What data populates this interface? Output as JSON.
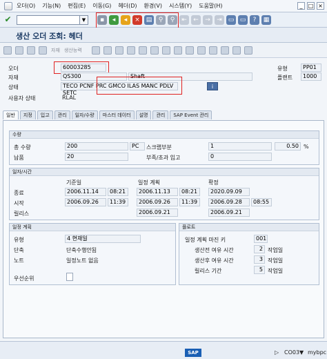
{
  "menu": {
    "items": [
      "오더(O)",
      "기능(N)",
      "편집(E)",
      "이동(G)",
      "헤더(D)",
      "환경(V)",
      "시스템(Y)",
      "도움말(H)"
    ]
  },
  "title": "생산 오더 조회: 헤더",
  "toolbar2": {
    "labels": [
      "자재",
      "생산능력"
    ]
  },
  "header": {
    "order_label": "오더",
    "order_value": "60003285",
    "type_label": "유형",
    "type_value": "PP01",
    "material_label": "자재",
    "material_value": "QS300",
    "material_desc": "Shaft",
    "plant_label": "플랜트",
    "plant_value": "1000",
    "status_label": "상태",
    "status_value": "TECO PCNF PRC  GMCO ILAS MANC PDLV SETC",
    "info_icon": "i",
    "user_status_label": "사용자 상태",
    "user_status_value": "RLAL"
  },
  "tabs": [
    "일반",
    "지정",
    "입고",
    "관리",
    "일자/수량",
    "마스터 데이터",
    "설명",
    "관리",
    "SAP Event 관리"
  ],
  "quantity": {
    "group_title": "수량",
    "total_label": "총 수량",
    "total_value": "200",
    "unit": "PC",
    "scrap_label": "스크랩부분",
    "scrap_value": "1",
    "scrap_pct": "0.50",
    "pct_sign": "%",
    "delivered_label": "납품",
    "delivered_value": "20",
    "short_label": "부족/초과 입고",
    "short_value": "0"
  },
  "dates": {
    "group_title": "일자/시간",
    "col_basic": "기준일",
    "col_sched": "일정 계획",
    "col_confirmed": "확정",
    "end_label": "종료",
    "end_basic": "2006.11.14",
    "end_basic_time": "08:21",
    "end_sched": "2006.11.13",
    "end_sched_time": "08:21",
    "end_confirmed": "2020.09.09",
    "start_label": "시작",
    "start_basic": "2006.09.26",
    "start_basic_time": "11:39",
    "start_sched": "2006.09.26",
    "start_sched_time": "11:39",
    "start_confirmed": "2006.09.28",
    "start_confirmed_time": "08:55",
    "release_label": "릴리스",
    "release_sched": "2006.09.21",
    "release_confirmed": "2006.09.21"
  },
  "scheduling": {
    "group_title": "일정 계획",
    "type_label": "유형",
    "type_value": "4 현재일",
    "reduction_label": "단축",
    "reduction_value": "단축수행안됨",
    "note_label": "노트",
    "note_value": "일정노트 없음",
    "priority_label": "우선순위"
  },
  "float": {
    "group_title": "플로트",
    "sched_margin_label": "일정 계획 마진 키",
    "sched_margin_value": "001",
    "before_label": "생산전 여유 시간",
    "before_value": "2",
    "after_label": "생산후 여유 시간",
    "after_value": "3",
    "release_label": "릴리스 기간",
    "release_value": "5",
    "unit_label": "작업일"
  },
  "status_bar": {
    "logo": "SAP",
    "session": "CO03",
    "server": "mybpc"
  }
}
